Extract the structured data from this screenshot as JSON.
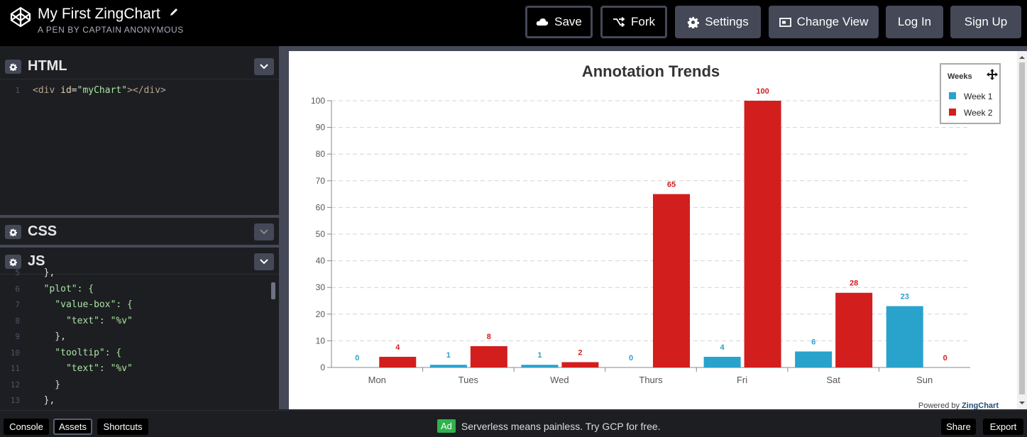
{
  "header": {
    "title": "My First ZingChart",
    "subtitle": "A PEN BY CAPTAIN ANONYMOUS",
    "buttons": {
      "save": "Save",
      "fork": "Fork",
      "settings": "Settings",
      "change_view": "Change View",
      "login": "Log In",
      "signup": "Sign Up"
    }
  },
  "editors": {
    "html": {
      "label": "HTML",
      "lines": [
        {
          "num": "1",
          "tag_open": "<div ",
          "attr": "id",
          "eq": "=",
          "str": "\"myChart\"",
          "tag_close": "></div>"
        }
      ]
    },
    "css": {
      "label": "CSS"
    },
    "js": {
      "label": "JS",
      "lines": [
        {
          "num": "5",
          "text": "  },"
        },
        {
          "num": "6",
          "text": "  \"plot\": {"
        },
        {
          "num": "7",
          "text": "    \"value-box\": {"
        },
        {
          "num": "8",
          "text": "      \"text\": \"%v\""
        },
        {
          "num": "9",
          "text": "    },"
        },
        {
          "num": "10",
          "text": "    \"tooltip\": {"
        },
        {
          "num": "11",
          "text": "      \"text\": \"%v\""
        },
        {
          "num": "12",
          "text": "    }"
        },
        {
          "num": "13",
          "text": "  },"
        }
      ]
    }
  },
  "chart_data": {
    "type": "bar",
    "title": "Annotation Trends",
    "categories": [
      "Mon",
      "Tues",
      "Wed",
      "Thurs",
      "Fri",
      "Sat",
      "Sun"
    ],
    "series": [
      {
        "name": "Week 1",
        "values": [
          0,
          1,
          1,
          0,
          4,
          6,
          23
        ],
        "color": "#29a2cc"
      },
      {
        "name": "Week 2",
        "values": [
          4,
          8,
          2,
          65,
          100,
          28,
          0
        ],
        "color": "#d31e1e"
      }
    ],
    "ylim": [
      0,
      100
    ],
    "yticks": [
      0,
      10,
      20,
      30,
      40,
      50,
      60,
      70,
      80,
      90,
      100
    ],
    "grid": true,
    "legend": {
      "title": "Weeks",
      "placement": "top-right"
    },
    "credit_prefix": "Powered by ",
    "credit_brand": "ZingChart"
  },
  "footer": {
    "console": "Console",
    "assets": "Assets",
    "shortcuts": "Shortcuts",
    "ad_badge": "Ad",
    "ad_text": "Serverless means painless. Try GCP for free.",
    "share": "Share",
    "export": "Export"
  }
}
